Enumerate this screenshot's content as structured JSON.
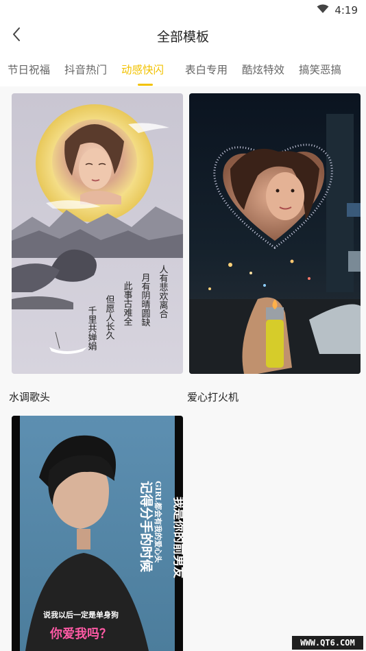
{
  "status_bar": {
    "time": "4:19",
    "wifi_icon": "wifi-icon",
    "battery_icon": "battery-icon"
  },
  "header": {
    "title": "全部模板",
    "back_icon": "chevron-left-icon"
  },
  "tabs": [
    {
      "label": "节日祝福",
      "active": false
    },
    {
      "label": "抖音热门",
      "active": false
    },
    {
      "label": "动感快闪",
      "active": true
    },
    {
      "label": "表白专用",
      "active": false
    },
    {
      "label": "酷炫特效",
      "active": false
    },
    {
      "label": "搞笑恶搞",
      "active": false
    }
  ],
  "accent_color": "#f2c200",
  "templates": [
    {
      "label": "水调歌头",
      "poem_lines": [
        "人有悲欢离合",
        "月有阴晴圆缺",
        "此事古难全",
        "但愿人长久",
        "千里共婵娟"
      ]
    },
    {
      "label": "爱心打火机"
    },
    {
      "label": "",
      "overlay_lines": [
        "我是你的前男友",
        "GIRL都会有我的爱心头",
        "记得分手的时候",
        "说我以后一定是单身狗",
        "你爱我吗？"
      ]
    }
  ],
  "watermark": "WWW.QT6.COM"
}
